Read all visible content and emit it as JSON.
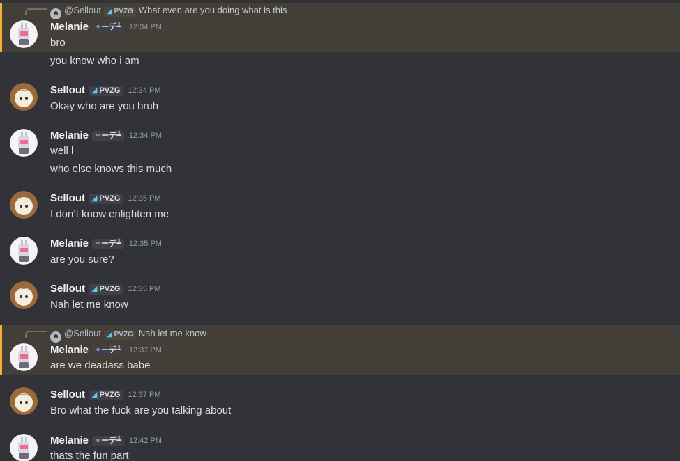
{
  "users": {
    "melanie": {
      "name": "Melanie",
      "tag": "ーデ┻"
    },
    "sellout": {
      "name": "Sellout",
      "tag": "PVZG"
    }
  },
  "messages": [
    {
      "reply": {
        "name": "@Sellout",
        "tag": "PVZG",
        "text": "What even are you doing what is this"
      },
      "author": "Melanie",
      "tag": "✧ーデ┻",
      "time": "12:34 PM",
      "lines": [
        "bro"
      ]
    },
    {
      "lines": [
        "you know who i am"
      ]
    },
    {
      "author": "Sellout",
      "tag": "PVZG",
      "time": "12:34 PM",
      "lines": [
        "Okay who are you bruh"
      ]
    },
    {
      "author": "Melanie",
      "tag": "✧ーデ┻",
      "time": "12:34 PM",
      "lines": [
        "well l",
        "who else knows this much"
      ]
    },
    {
      "author": "Sellout",
      "tag": "PVZG",
      "time": "12:35 PM",
      "lines": [
        "I don’t know enlighten me"
      ]
    },
    {
      "author": "Melanie",
      "tag": "✧ーデ┻",
      "time": "12:35 PM",
      "lines": [
        "are you sure?"
      ]
    },
    {
      "author": "Sellout",
      "tag": "PVZG",
      "time": "12:35 PM",
      "lines": [
        "Nah let me know"
      ]
    },
    {
      "reply": {
        "name": "@Sellout",
        "tag": "PVZG",
        "text": "Nah let me know"
      },
      "author": "Melanie",
      "tag": "✧ーデ┻",
      "time": "12:37 PM",
      "lines": [
        "are we deadass babe"
      ]
    },
    {
      "author": "Sellout",
      "tag": "PVZG",
      "time": "12:37 PM",
      "lines": [
        "Bro what the fuck are you talking about"
      ]
    },
    {
      "author": "Melanie",
      "tag": "✧ーデ┻",
      "time": "12:42 PM",
      "lines": [
        "thats the fun part"
      ]
    }
  ],
  "colors": {
    "background": "#313338",
    "mention_bg": "#433f38",
    "mention_bar": "#f0b232",
    "badge_icon": "#5fc8f0"
  }
}
